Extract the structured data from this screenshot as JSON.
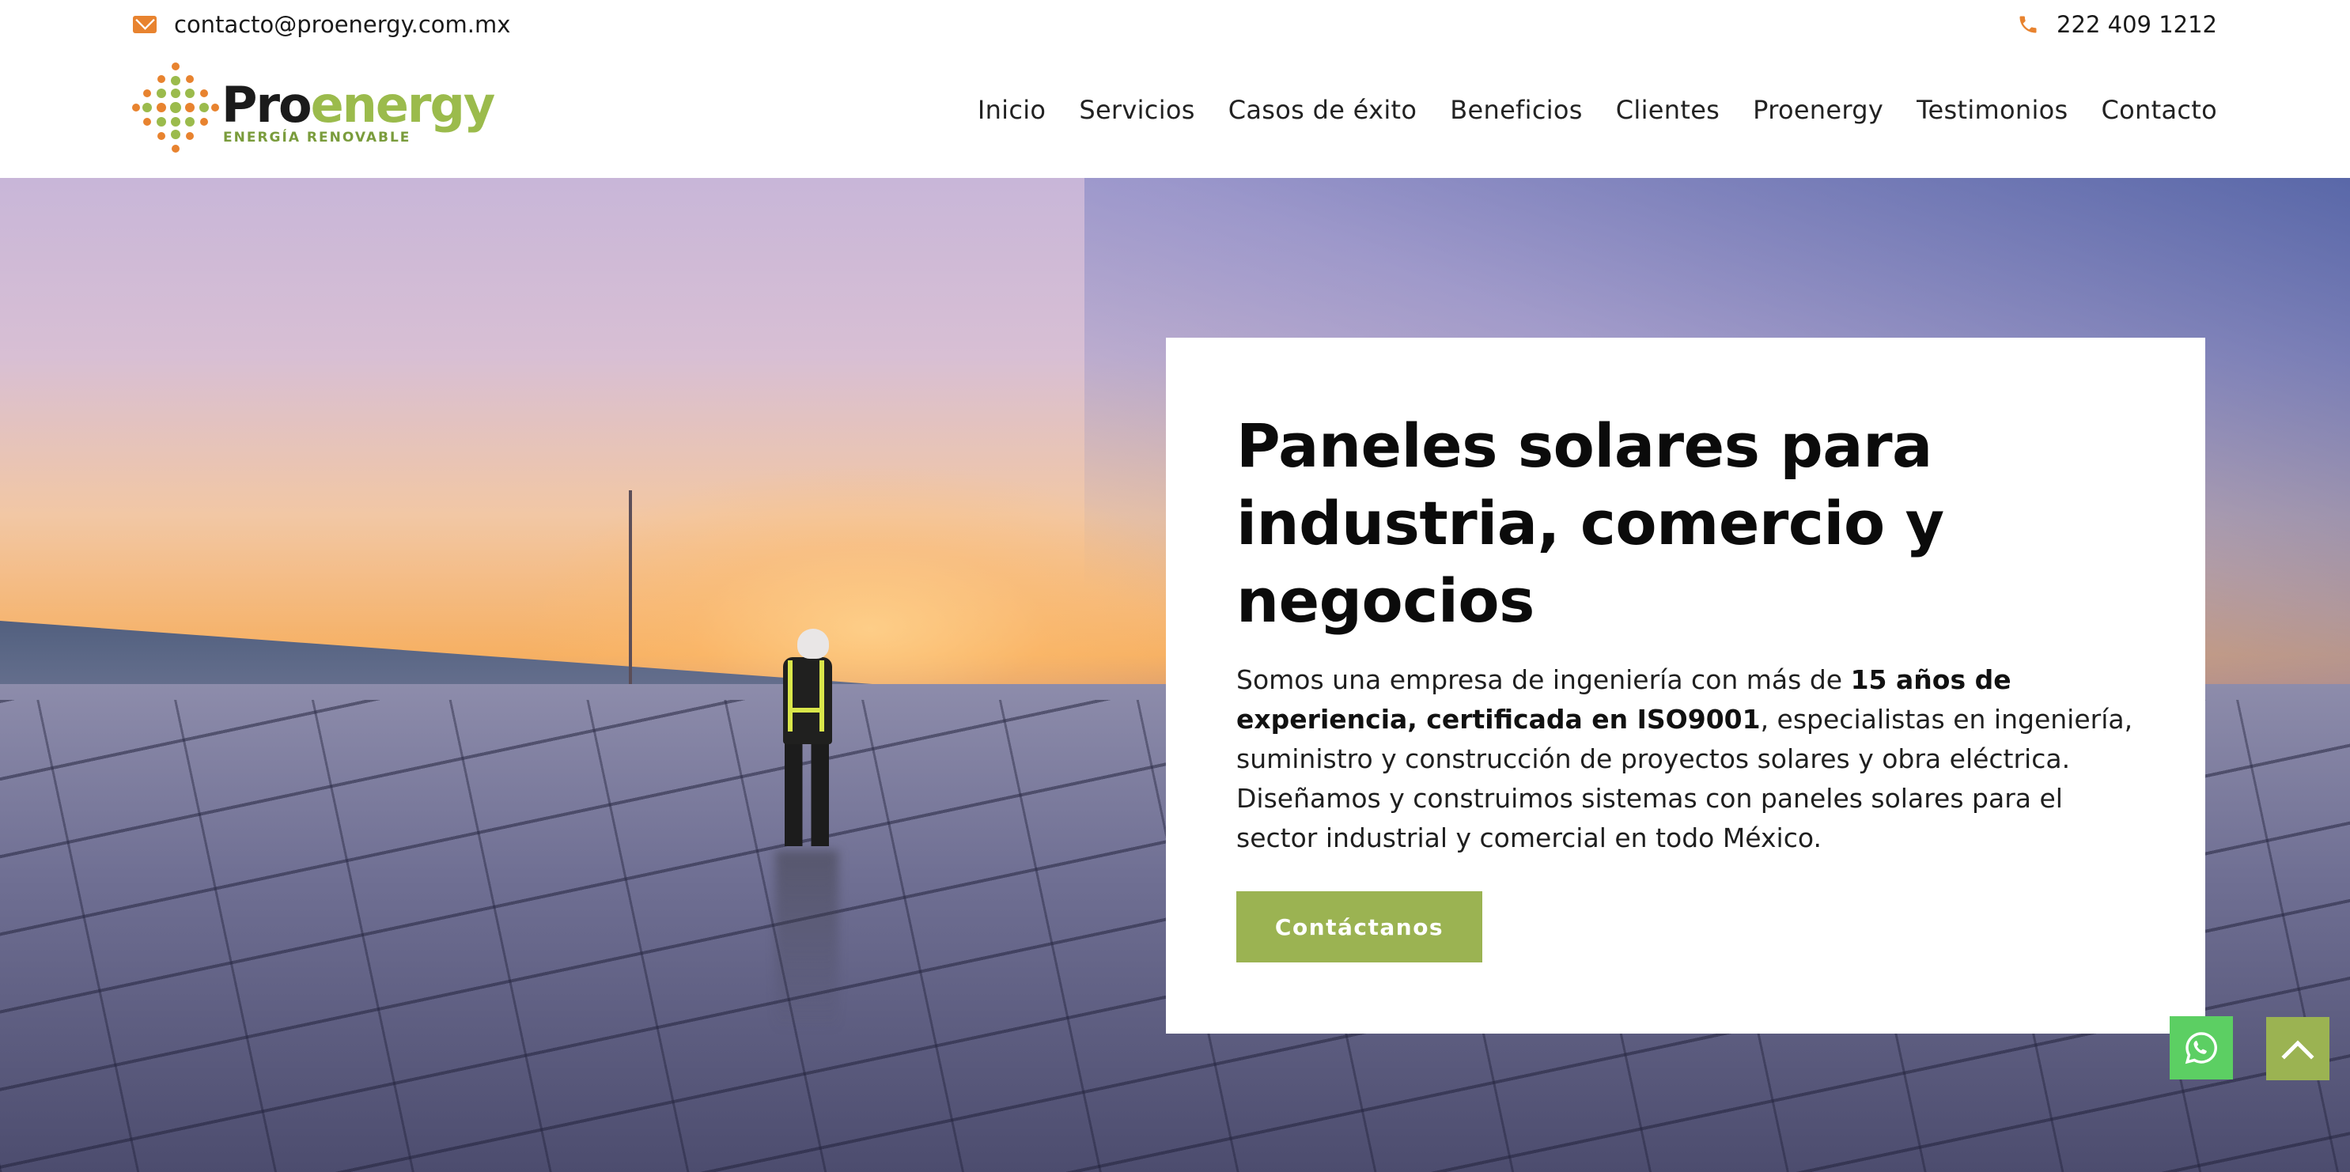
{
  "topbar": {
    "email": "contacto@proenergy.com.mx",
    "phone": "222 409 1212",
    "email_icon": "envelope-icon",
    "phone_icon": "phone-icon"
  },
  "brand": {
    "name_part1": "Pro",
    "name_part2": "energy",
    "tagline": "ENERGÍA RENOVABLE",
    "primary_color": "#9bb352",
    "accent_color": "#e8832f"
  },
  "nav": {
    "items": [
      {
        "label": "Inicio"
      },
      {
        "label": "Servicios"
      },
      {
        "label": "Casos de éxito"
      },
      {
        "label": "Beneficios"
      },
      {
        "label": "Clientes"
      },
      {
        "label": "Proenergy"
      },
      {
        "label": "Testimonios"
      },
      {
        "label": "Contacto"
      }
    ]
  },
  "hero": {
    "title": "Paneles solares para industria, comercio y negocios",
    "lead_part1": "Somos una empresa de ingeniería con más de ",
    "lead_bold": "15 años de experiencia, certificada en ISO9001",
    "lead_part2": ", especialistas en ingeniería, suministro y construcción de proyectos solares y obra eléctrica. Diseñamos y construimos sistemas con paneles solares para el sector industrial y comercial en todo México.",
    "cta_label": "Contáctanos"
  },
  "floating": {
    "whatsapp_icon": "whatsapp-icon",
    "back_to_top_icon": "chevron-up-icon",
    "whatsapp_color": "#5ccf63"
  }
}
